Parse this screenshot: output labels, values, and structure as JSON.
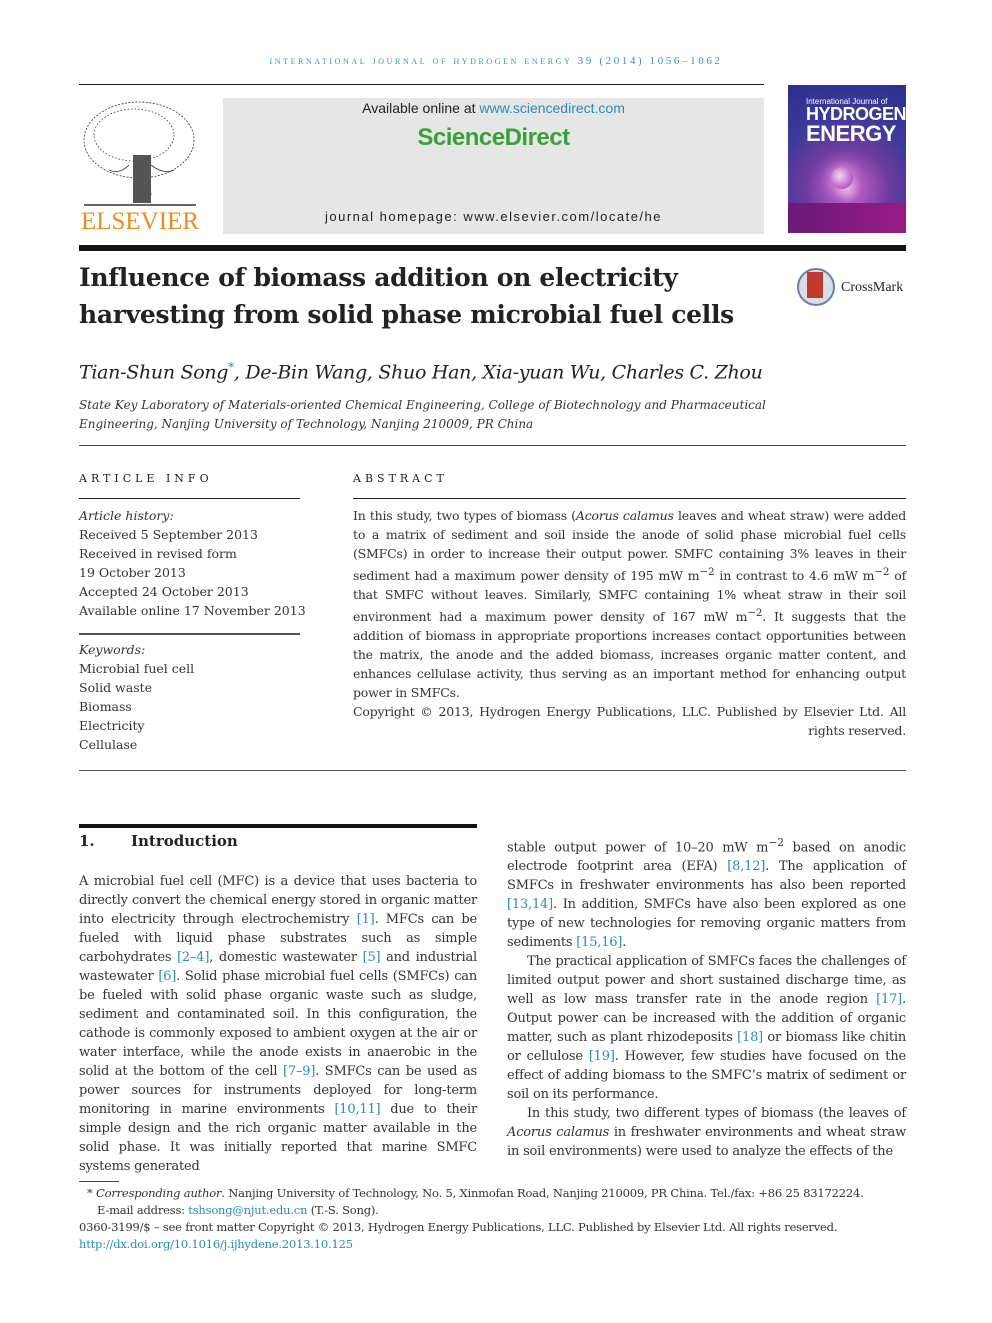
{
  "running_head": "International Journal of Hydrogen Energy 39 (2014) 1056–1062",
  "header": {
    "publisher": "ELSEVIER",
    "available_online_prefix": "Available online at ",
    "available_online_link": "www.sciencedirect.com",
    "brand": "ScienceDirect",
    "journal_homepage_prefix": "journal homepage: ",
    "journal_homepage_url": "www.elsevier.com/locate/he",
    "cover": {
      "line1": "International Journal of",
      "line2": "HYDROGEN",
      "line3": "ENERGY"
    },
    "crossmark_label": "CrossMark"
  },
  "article": {
    "title": "Influence of biomass addition on electricity harvesting from solid phase microbial fuel cells",
    "authors": [
      {
        "name": "Tian-Shun Song",
        "mark": "*"
      },
      {
        "name": "De-Bin Wang",
        "mark": ""
      },
      {
        "name": "Shuo Han",
        "mark": ""
      },
      {
        "name": "Xia-yuan Wu",
        "mark": ""
      },
      {
        "name": "Charles C. Zhou",
        "mark": ""
      }
    ],
    "affiliation": "State Key Laboratory of Materials-oriented Chemical Engineering, College of Biotechnology and Pharmaceutical Engineering, Nanjing University of Technology, Nanjing 210009, PR China"
  },
  "article_info": {
    "heading": "ARTICLE INFO",
    "history_label": "Article history:",
    "history": [
      "Received 5 September 2013",
      "Received in revised form",
      "19 October 2013",
      "Accepted 24 October 2013",
      "Available online 17 November 2013"
    ],
    "keywords_label": "Keywords:",
    "keywords": [
      "Microbial fuel cell",
      "Solid waste",
      "Biomass",
      "Electricity",
      "Cellulase"
    ]
  },
  "abstract": {
    "heading": "ABSTRACT",
    "p1_a": "In this study, two types of biomass (",
    "p1_italic": "Acorus calamus",
    "p1_b": " leaves and wheat straw) were added to a matrix of sediment and soil inside the anode of solid phase microbial fuel cells (SMFCs) in order to increase their output power. SMFC containing 3% leaves in their sediment had a maximum power density of 195 mW m",
    "sup1": "−2",
    "p1_c": " in contrast to 4.6 mW m",
    "sup2": "−2",
    "p1_d": " of that SMFC without leaves. Similarly, SMFC containing 1% wheat straw in their soil environment had a maximum power density of 167 mW m",
    "sup3": "−2",
    "p1_e": ". It suggests that the addition of biomass in appropriate proportions increases contact opportunities between the matrix, the anode and the added biomass, increases organic matter content, and enhances cellulase activity, thus serving as an important method for enhancing output power in SMFCs.",
    "copyright": "Copyright © 2013, Hydrogen Energy Publications, LLC. Published by Elsevier Ltd. All rights reserved."
  },
  "introduction": {
    "number": "1.",
    "heading": "Introduction",
    "col1": {
      "t1": "A microbial fuel cell (MFC) is a device that uses bacteria to directly convert the chemical energy stored in organic matter into electricity through electrochemistry ",
      "r1": "[1]",
      "t2": ". MFCs can be fueled with liquid phase substrates such as simple carbohydrates ",
      "r2": "[2–4]",
      "t3": ", domestic wastewater ",
      "r3": "[5]",
      "t4": " and industrial wastewater ",
      "r4": "[6]",
      "t5": ". Solid phase microbial fuel cells (SMFCs) can be fueled with solid phase organic waste such as sludge, sediment and contaminated soil. In this configuration, the cathode is commonly exposed to ambient oxygen at the air or water interface, while the anode exists in anaerobic in the solid at the bottom of the cell ",
      "r5": "[7–9]",
      "t6": ". SMFCs can be used as power sources for instruments deployed for long-term monitoring in marine environments ",
      "r6": "[10,11]",
      "t7": " due to their simple design and the rich organic matter available in the solid phase. It was initially reported that marine SMFC systems generated"
    },
    "col2": {
      "t1": "stable output power of 10–20 mW m",
      "sup": "−2",
      "t2": " based on anodic electrode footprint area (EFA) ",
      "r1": "[8,12]",
      "t3": ". The application of SMFCs in freshwater environments has also been reported ",
      "r2": "[13,14]",
      "t4": ". In addition, SMFCs have also been explored as one type of new technologies for removing organic matters from sediments ",
      "r3": "[15,16]",
      "t5": ".",
      "p2_t1": "The practical application of SMFCs faces the challenges of limited output power and short sustained discharge time, as well as low mass transfer rate in the anode region ",
      "p2_r1": "[17]",
      "p2_t2": ". Output power can be increased with the addition of organic matter, such as plant rhizodeposits ",
      "p2_r2": "[18]",
      "p2_t3": " or biomass like chitin or cellulose ",
      "p2_r3": "[19]",
      "p2_t4": ". However, few studies have focused on the effect of adding biomass to the SMFC’s matrix of sediment or soil on its performance.",
      "p3_t1": "In this study, two different types of biomass (the leaves of ",
      "p3_italic": "Acorus calamus",
      "p3_t2": " in freshwater environments and wheat straw in soil environments) were used to analyze the effects of the"
    }
  },
  "footnotes": {
    "star": "* ",
    "corr_label": "Corresponding author",
    "corr_text": ". Nanjing University of Technology, No. 5, Xinmofan Road, Nanjing 210009, PR China. Tel./fax: +86 25 83172224.",
    "email_label": "E-mail address: ",
    "email": "tshsong@njut.edu.cn",
    "email_suffix": " (T.-S. Song).",
    "front_matter": "0360-3199/$ – see front matter Copyright © 2013, Hydrogen Energy Publications, LLC. Published by Elsevier Ltd. All rights reserved.",
    "doi": "http://dx.doi.org/10.1016/j.ijhydene.2013.10.125"
  }
}
